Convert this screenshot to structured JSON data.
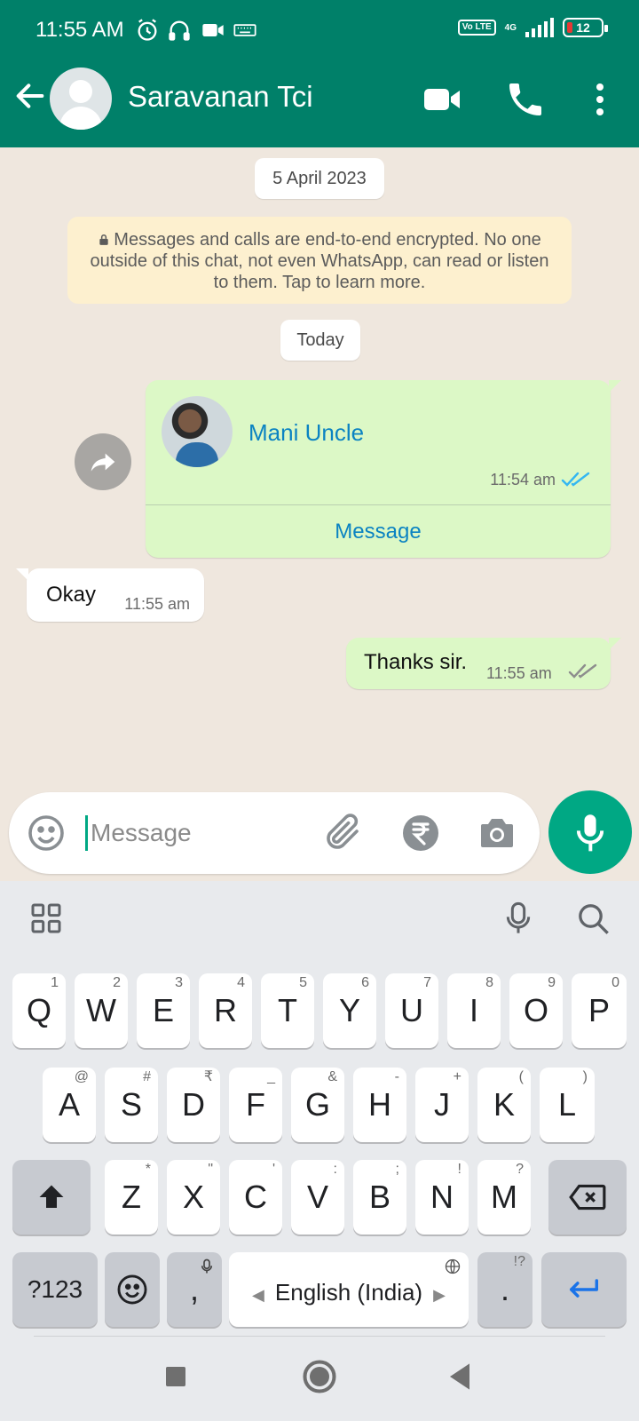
{
  "status_bar": {
    "time": "11:55 AM",
    "icons": [
      "alarm-icon",
      "headphones-icon",
      "video-icon",
      "keyboard-icon"
    ],
    "volte": "Vo LTE",
    "network": "4G",
    "battery": "12"
  },
  "header": {
    "contact_name": "Saravanan Tci",
    "icons": [
      "back-arrow-icon",
      "video-call-icon",
      "voice-call-icon",
      "more-options-icon"
    ]
  },
  "chat": {
    "date_divider": "5 April 2023",
    "encryption_notice": "Messages and calls are end-to-end encrypted. No one outside of this chat, not even WhatsApp, can read or listen to them. Tap to learn more.",
    "today_divider": "Today",
    "contact_card": {
      "name": "Mani Uncle",
      "time": "11:54 am",
      "status": "read",
      "action_label": "Message"
    },
    "messages": [
      {
        "direction": "incoming",
        "text": "Okay",
        "time": "11:55 am"
      },
      {
        "direction": "outgoing",
        "text": "Thanks sir.",
        "time": "11:55 am",
        "status": "delivered"
      }
    ]
  },
  "composer": {
    "placeholder": "Message",
    "icons": [
      "emoji-icon",
      "attach-icon",
      "rupee-payment-icon",
      "camera-icon",
      "mic-icon"
    ]
  },
  "keyboard": {
    "row1": [
      {
        "label": "Q",
        "hint": "1"
      },
      {
        "label": "W",
        "hint": "2"
      },
      {
        "label": "E",
        "hint": "3"
      },
      {
        "label": "R",
        "hint": "4"
      },
      {
        "label": "T",
        "hint": "5"
      },
      {
        "label": "Y",
        "hint": "6"
      },
      {
        "label": "U",
        "hint": "7"
      },
      {
        "label": "I",
        "hint": "8"
      },
      {
        "label": "O",
        "hint": "9"
      },
      {
        "label": "P",
        "hint": "0"
      }
    ],
    "row2": [
      {
        "label": "A",
        "hint": "@"
      },
      {
        "label": "S",
        "hint": "#"
      },
      {
        "label": "D",
        "hint": "₹"
      },
      {
        "label": "F",
        "hint": "_"
      },
      {
        "label": "G",
        "hint": "&"
      },
      {
        "label": "H",
        "hint": "-"
      },
      {
        "label": "J",
        "hint": "+"
      },
      {
        "label": "K",
        "hint": "("
      },
      {
        "label": "L",
        "hint": ")"
      }
    ],
    "row3": [
      {
        "label": "Z",
        "hint": "*"
      },
      {
        "label": "X",
        "hint": "\""
      },
      {
        "label": "C",
        "hint": "'"
      },
      {
        "label": "V",
        "hint": ":"
      },
      {
        "label": "B",
        "hint": ";"
      },
      {
        "label": "N",
        "hint": "!"
      },
      {
        "label": "M",
        "hint": "?"
      }
    ],
    "symbols_label": "?123",
    "comma_label": ",",
    "space_label": "English (India)",
    "period_label": ".",
    "period_hint": "!?",
    "accent_color": "#1a73e8"
  },
  "colors": {
    "header": "#008069",
    "accent": "#00a884",
    "outgoing_bubble": "#dcf8c6",
    "read_ticks": "#34b7f1"
  }
}
